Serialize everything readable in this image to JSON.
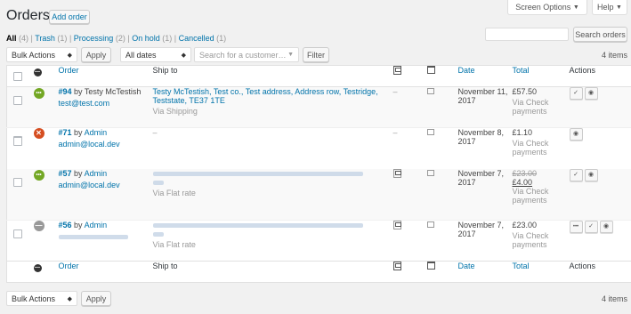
{
  "page": {
    "title": "Orders",
    "add_order": "Add order",
    "screen_options": "Screen Options",
    "help": "Help",
    "dropdown_arrow": "▼"
  },
  "views": [
    {
      "label": "All",
      "count": "(4)"
    },
    {
      "label": "Trash",
      "count": "(1)"
    },
    {
      "label": "Processing",
      "count": "(2)"
    },
    {
      "label": "On hold",
      "count": "(1)"
    },
    {
      "label": "Cancelled",
      "count": "(1)"
    }
  ],
  "search": {
    "button": "Search orders",
    "value": ""
  },
  "toolbar": {
    "bulk_actions": "Bulk Actions",
    "apply": "Apply",
    "dates": "All dates",
    "customer_placeholder": "Search for a customer…",
    "filter": "Filter",
    "items": "4 items"
  },
  "columns": {
    "order": "Order",
    "ship_to": "Ship to",
    "date": "Date",
    "total": "Total",
    "actions": "Actions"
  },
  "rows": [
    {
      "order_number": "#94",
      "by": "by",
      "customer": "Testy McTestish",
      "email": "test@test.com",
      "ship_line1": "Testy McTestish, Test co., Test address, Address row, Testridge,",
      "ship_line2": "Teststate, TE37 1TE",
      "ship_via": "Via Shipping",
      "billing": "–",
      "date_line1": "November 11,",
      "date_line2": "2017",
      "total": "£57.50",
      "pay1": "Via Check",
      "pay2": "payments",
      "status_color": "#73a724",
      "status_icon": "•••",
      "actions": [
        "complete-icon",
        "view-icon"
      ]
    },
    {
      "order_number": "#71",
      "by": "by",
      "customer": "Admin",
      "email": "admin@local.dev",
      "ship_line1": "–",
      "ship_line2": "",
      "ship_via": "",
      "billing": "–",
      "date_line1": "November 8,",
      "date_line2": "2017",
      "total": "£1.10",
      "pay1": "Via Check",
      "pay2": "payments",
      "status_color": "#d54e21",
      "status_icon": "✕",
      "actions": [
        "view-icon"
      ]
    },
    {
      "order_number": "#57",
      "by": "by",
      "customer": "Admin",
      "email": "admin@local.dev",
      "ship_via": "Via Flat rate",
      "date_line1": "November 7,",
      "date_line2": "2017",
      "total_old": "£23.00",
      "total": "£4.00",
      "pay1": "Via Check",
      "pay2": "payments",
      "status_color": "#73a724",
      "status_icon": "•••",
      "actions": [
        "complete-icon",
        "view-icon"
      ]
    },
    {
      "order_number": "#56",
      "by": "by",
      "customer": "Admin",
      "ship_via": "Via Flat rate",
      "date_line1": "November 7,",
      "date_line2": "2017",
      "total": "£23.00",
      "pay1": "Via Check",
      "pay2": "payments",
      "status_color": "#999999",
      "status_icon": "—",
      "actions": [
        "processing-icon",
        "complete-icon",
        "view-icon"
      ]
    }
  ],
  "bottom": {
    "bulk_actions": "Bulk Actions",
    "apply": "Apply",
    "items": "4 items"
  },
  "icons": {
    "complete": "✓",
    "view": "◉",
    "processing": "•••"
  }
}
